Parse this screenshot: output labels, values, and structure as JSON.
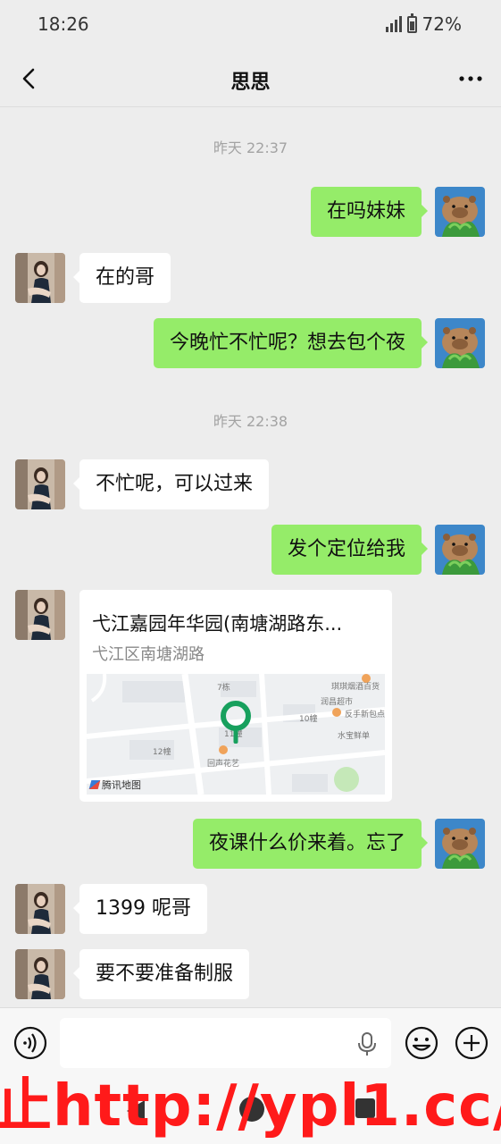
{
  "status_bar": {
    "time": "18:26",
    "battery": "72%"
  },
  "header": {
    "title": "思思",
    "back_icon": "chevron-left-icon",
    "more_icon": "more-dots-icon"
  },
  "messages": [
    {
      "type": "timestamp",
      "text": "昨天 22:37"
    },
    {
      "type": "text",
      "side": "out",
      "text": "在吗妹妹"
    },
    {
      "type": "text",
      "side": "in",
      "text": "在的哥"
    },
    {
      "type": "text",
      "side": "out",
      "text": "今晚忙不忙呢？想去包个夜"
    },
    {
      "type": "timestamp",
      "text": "昨天 22:38"
    },
    {
      "type": "text",
      "side": "in",
      "text": "不忙呢，可以过来"
    },
    {
      "type": "text",
      "side": "out",
      "text": "发个定位给我"
    },
    {
      "type": "location",
      "side": "in",
      "name": "弋江嘉园年华园(南塘湖路东...",
      "address": "弋江区南塘湖路",
      "map_labels": [
        "7栋",
        "琪琪烟酒百货",
        "润昌超市",
        "反手新包点",
        "10幢",
        "水宝鲜单",
        "11幢",
        "12幢",
        "回声花艺"
      ],
      "map_provider": "腾讯地图"
    },
    {
      "type": "text",
      "side": "out",
      "text": "夜课什么价来着。忘了"
    },
    {
      "type": "text",
      "side": "in",
      "text": "1399 呢哥"
    },
    {
      "type": "text",
      "side": "in",
      "text": "要不要准备制服"
    }
  ],
  "input_bar": {
    "voice_icon": "voice-icon",
    "mic_icon": "mic-icon",
    "emoji_icon": "emoji-icon",
    "plus_icon": "plus-icon",
    "value": ""
  },
  "watermark": "止http://ypl1.cc/",
  "colors": {
    "background": "#ededed",
    "out_bubble": "#95ec69",
    "in_bubble": "#ffffff",
    "watermark": "#ff1a1a",
    "map_pin": "#17a05d"
  }
}
